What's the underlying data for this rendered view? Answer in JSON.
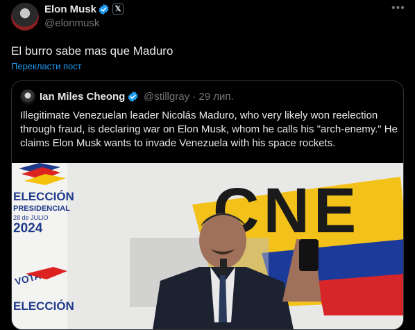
{
  "post": {
    "author_name": "Elon Musk",
    "author_handle": "@elonmusk",
    "text": "El burro sabe mas que Maduro",
    "translate_label": "Перекласти пост",
    "more_icon": "more-icon"
  },
  "quoted": {
    "author_name": "Ian Miles Cheong",
    "author_handle": "@stillgray",
    "separator": "·",
    "date": "29 лип.",
    "text": "Illegitimate Venezuelan leader Nicolás Maduro, who very likely won reelection through fraud, is declaring war on Elon Musk, whom he calls his \"arch-enemy.\" He claims Elon Musk wants to invade Venezuela with his space rockets.",
    "image": {
      "left_banner_lines": [
        "ELECCIÓN",
        "PRESIDENCIAL",
        "28 de JULIO",
        "2024"
      ],
      "left_banner_vote": "VOTA",
      "left_banner_bottom": "ELECCIÓN",
      "logo_text": "CNE"
    }
  },
  "colors": {
    "background": "#000000",
    "text": "#e7e9ea",
    "secondary": "#71767b",
    "accent": "#1d9bf0",
    "border": "#2f3336"
  }
}
